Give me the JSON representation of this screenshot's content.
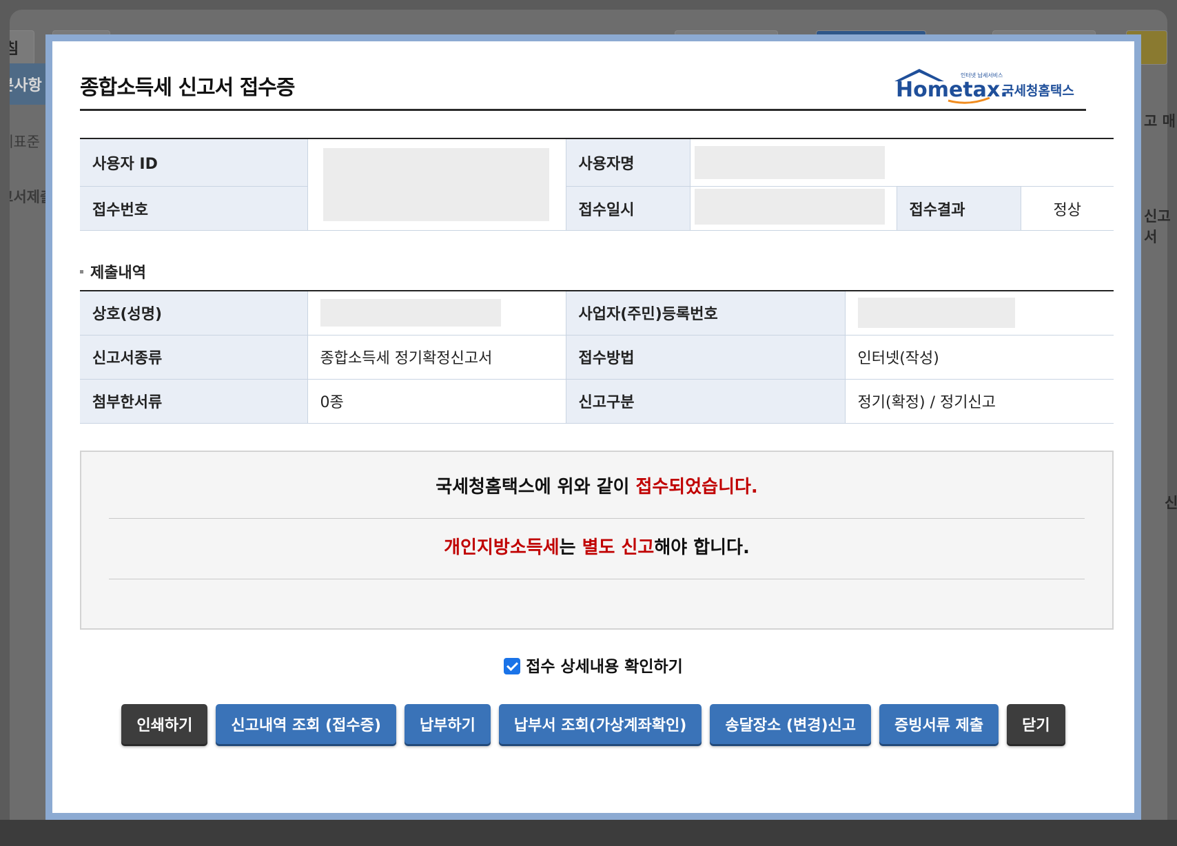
{
  "background": {
    "tab_left": "침",
    "side_item_1": "본사항",
    "text_1": "세표준",
    "text_2": "고서제출",
    "right_text_1": "고 매",
    "right_text_2": "신고서",
    "right_text_3": "신"
  },
  "modal": {
    "title": "종합소득세 신고서 접수증",
    "logo": {
      "brand": "Hometax.",
      "small_text": "인터넷 납세서비스",
      "name": "국세청홈택스",
      "brand_color": "#1f4f9a",
      "accent_color": "#f08c1f"
    },
    "receipt_table": {
      "user_id_label": "사용자 ID",
      "user_name_label": "사용자명",
      "receipt_no_label": "접수번호",
      "receipt_datetime_label": "접수일시",
      "receipt_result_label": "접수결과",
      "receipt_result_value": "정상"
    },
    "submission": {
      "section_title": "제출내역",
      "rows": [
        {
          "label1": "상호(성명)",
          "value1": "",
          "label2": "사업자(주민)등록번호",
          "value2": ""
        },
        {
          "label1": "신고서종류",
          "value1": "종합소득세 정기확정신고서",
          "label2": "접수방법",
          "value2": "인터넷(작성)"
        },
        {
          "label1": "첨부한서류",
          "value1": "0종",
          "label2": "신고구분",
          "value2": "정기(확정) / 정기신고"
        }
      ]
    },
    "notice": {
      "line1_prefix": "국세청홈택스에 위와 같이 ",
      "line1_highlight": "접수되었습니다.",
      "line2_highlight1": "개인지방소득세",
      "line2_mid": "는 ",
      "line2_highlight2": "별도 신고",
      "line2_suffix": "해야 합니다.",
      "highlight_color": "#c00000"
    },
    "checkbox": {
      "label": "접수 상세내용 확인하기",
      "checked": true
    },
    "buttons": [
      {
        "label": "인쇄하기",
        "style": "dark"
      },
      {
        "label": "신고내역 조회 (접수증)",
        "style": "blue"
      },
      {
        "label": "납부하기",
        "style": "blue"
      },
      {
        "label": "납부서 조회(가상계좌확인)",
        "style": "blue"
      },
      {
        "label": "송달장소 (변경)신고",
        "style": "blue"
      },
      {
        "label": "증빙서류 제출",
        "style": "blue"
      },
      {
        "label": "닫기",
        "style": "dark"
      }
    ]
  }
}
